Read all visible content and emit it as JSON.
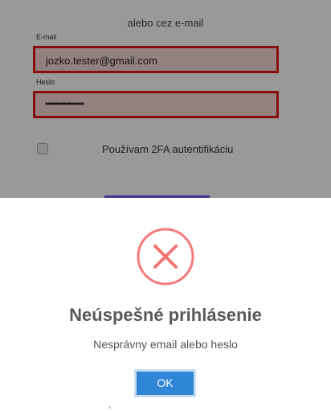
{
  "form": {
    "alt_login_text": "alebo cez e-mail",
    "email": {
      "label": "E-mail",
      "value": "jozko.tester@gmail.com"
    },
    "password": {
      "label": "Heslo",
      "masked_value": "•••••••••••••••"
    },
    "two_fa": {
      "label": "Používam 2FA autentifikáciu",
      "checked": false
    }
  },
  "dialog": {
    "icon": "error-x-icon",
    "title": "Neúspešné prihlásenie",
    "message": "Nesprávny email alebo heslo",
    "confirm_label": "OK"
  },
  "colors": {
    "error_border": "#e8141a",
    "error_icon": "#f27474",
    "primary_button": "#3085d6",
    "submit_button": "#6a5af9"
  }
}
